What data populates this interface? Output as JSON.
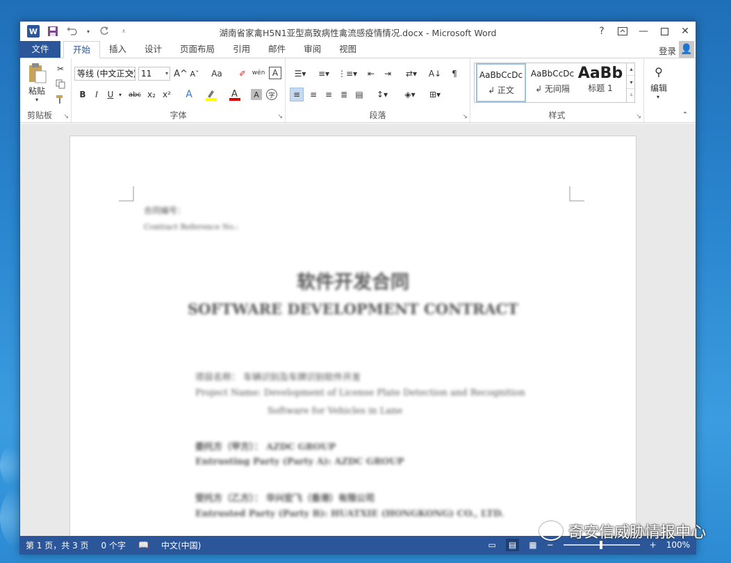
{
  "window": {
    "title": "湖南省家禽H5N1亚型高致病性禽流感疫情情况.docx - Microsoft Word",
    "help": "?",
    "accent": "#2b579a"
  },
  "tabs": {
    "file": "文件",
    "items": [
      "开始",
      "插入",
      "设计",
      "页面布局",
      "引用",
      "邮件",
      "审阅",
      "视图"
    ],
    "active": "开始",
    "login": "登录"
  },
  "ribbon": {
    "clipboard": {
      "label": "剪贴板",
      "paste": "粘贴"
    },
    "font": {
      "label": "字体",
      "font_name": "等线 (中文正文)",
      "font_size": "11",
      "bold": "B",
      "italic": "I",
      "underline": "U",
      "strike": "abc",
      "sub": "x₂",
      "sup": "x²",
      "grow": "A^",
      "shrink": "Aˇ",
      "case": "Aa",
      "phonetic": "wén",
      "border_char": "A"
    },
    "paragraph": {
      "label": "段落"
    },
    "styles": {
      "label": "样式",
      "items": [
        {
          "sample": "AaBbCcDc",
          "name": "↲ 正文"
        },
        {
          "sample": "AaBbCcDc",
          "name": "↲ 无间隔"
        },
        {
          "sample": "AaBb",
          "name": "标题 1"
        }
      ]
    },
    "editing": {
      "label": "编辑"
    }
  },
  "document": {
    "ref_label_cn": "合同编号：",
    "ref_label_en": "Contract Reference No.:",
    "title_cn": "软件开发合同",
    "title_en": "SOFTWARE DEVELOPMENT CONTRACT",
    "project_cn": "项目名称：  车辆识别及车牌识别软件开发",
    "project_en_1": "Project Name: Development of License Plate Detection and Recognition",
    "project_en_2": "Software for Vehicles in Lane",
    "party_a_cn": "委托方（甲方）：  AZDC GROUP",
    "party_a_en": "Entrusting Party (Party A): AZDC GROUP",
    "party_b_cn": "受托方（乙方）：  华兴宏飞（香港）有限公司",
    "party_b_en": "Entrusted Party (Party B): HUATXIE (HONGKONG) CO., LTD."
  },
  "status": {
    "page": "第 1 页，共 3 页",
    "words": "0 个字",
    "lang": "中文(中国)",
    "zoom": "100%",
    "zoom_minus": "−",
    "zoom_plus": "+"
  },
  "watermark": {
    "text": "奇安信威胁情报中心"
  }
}
